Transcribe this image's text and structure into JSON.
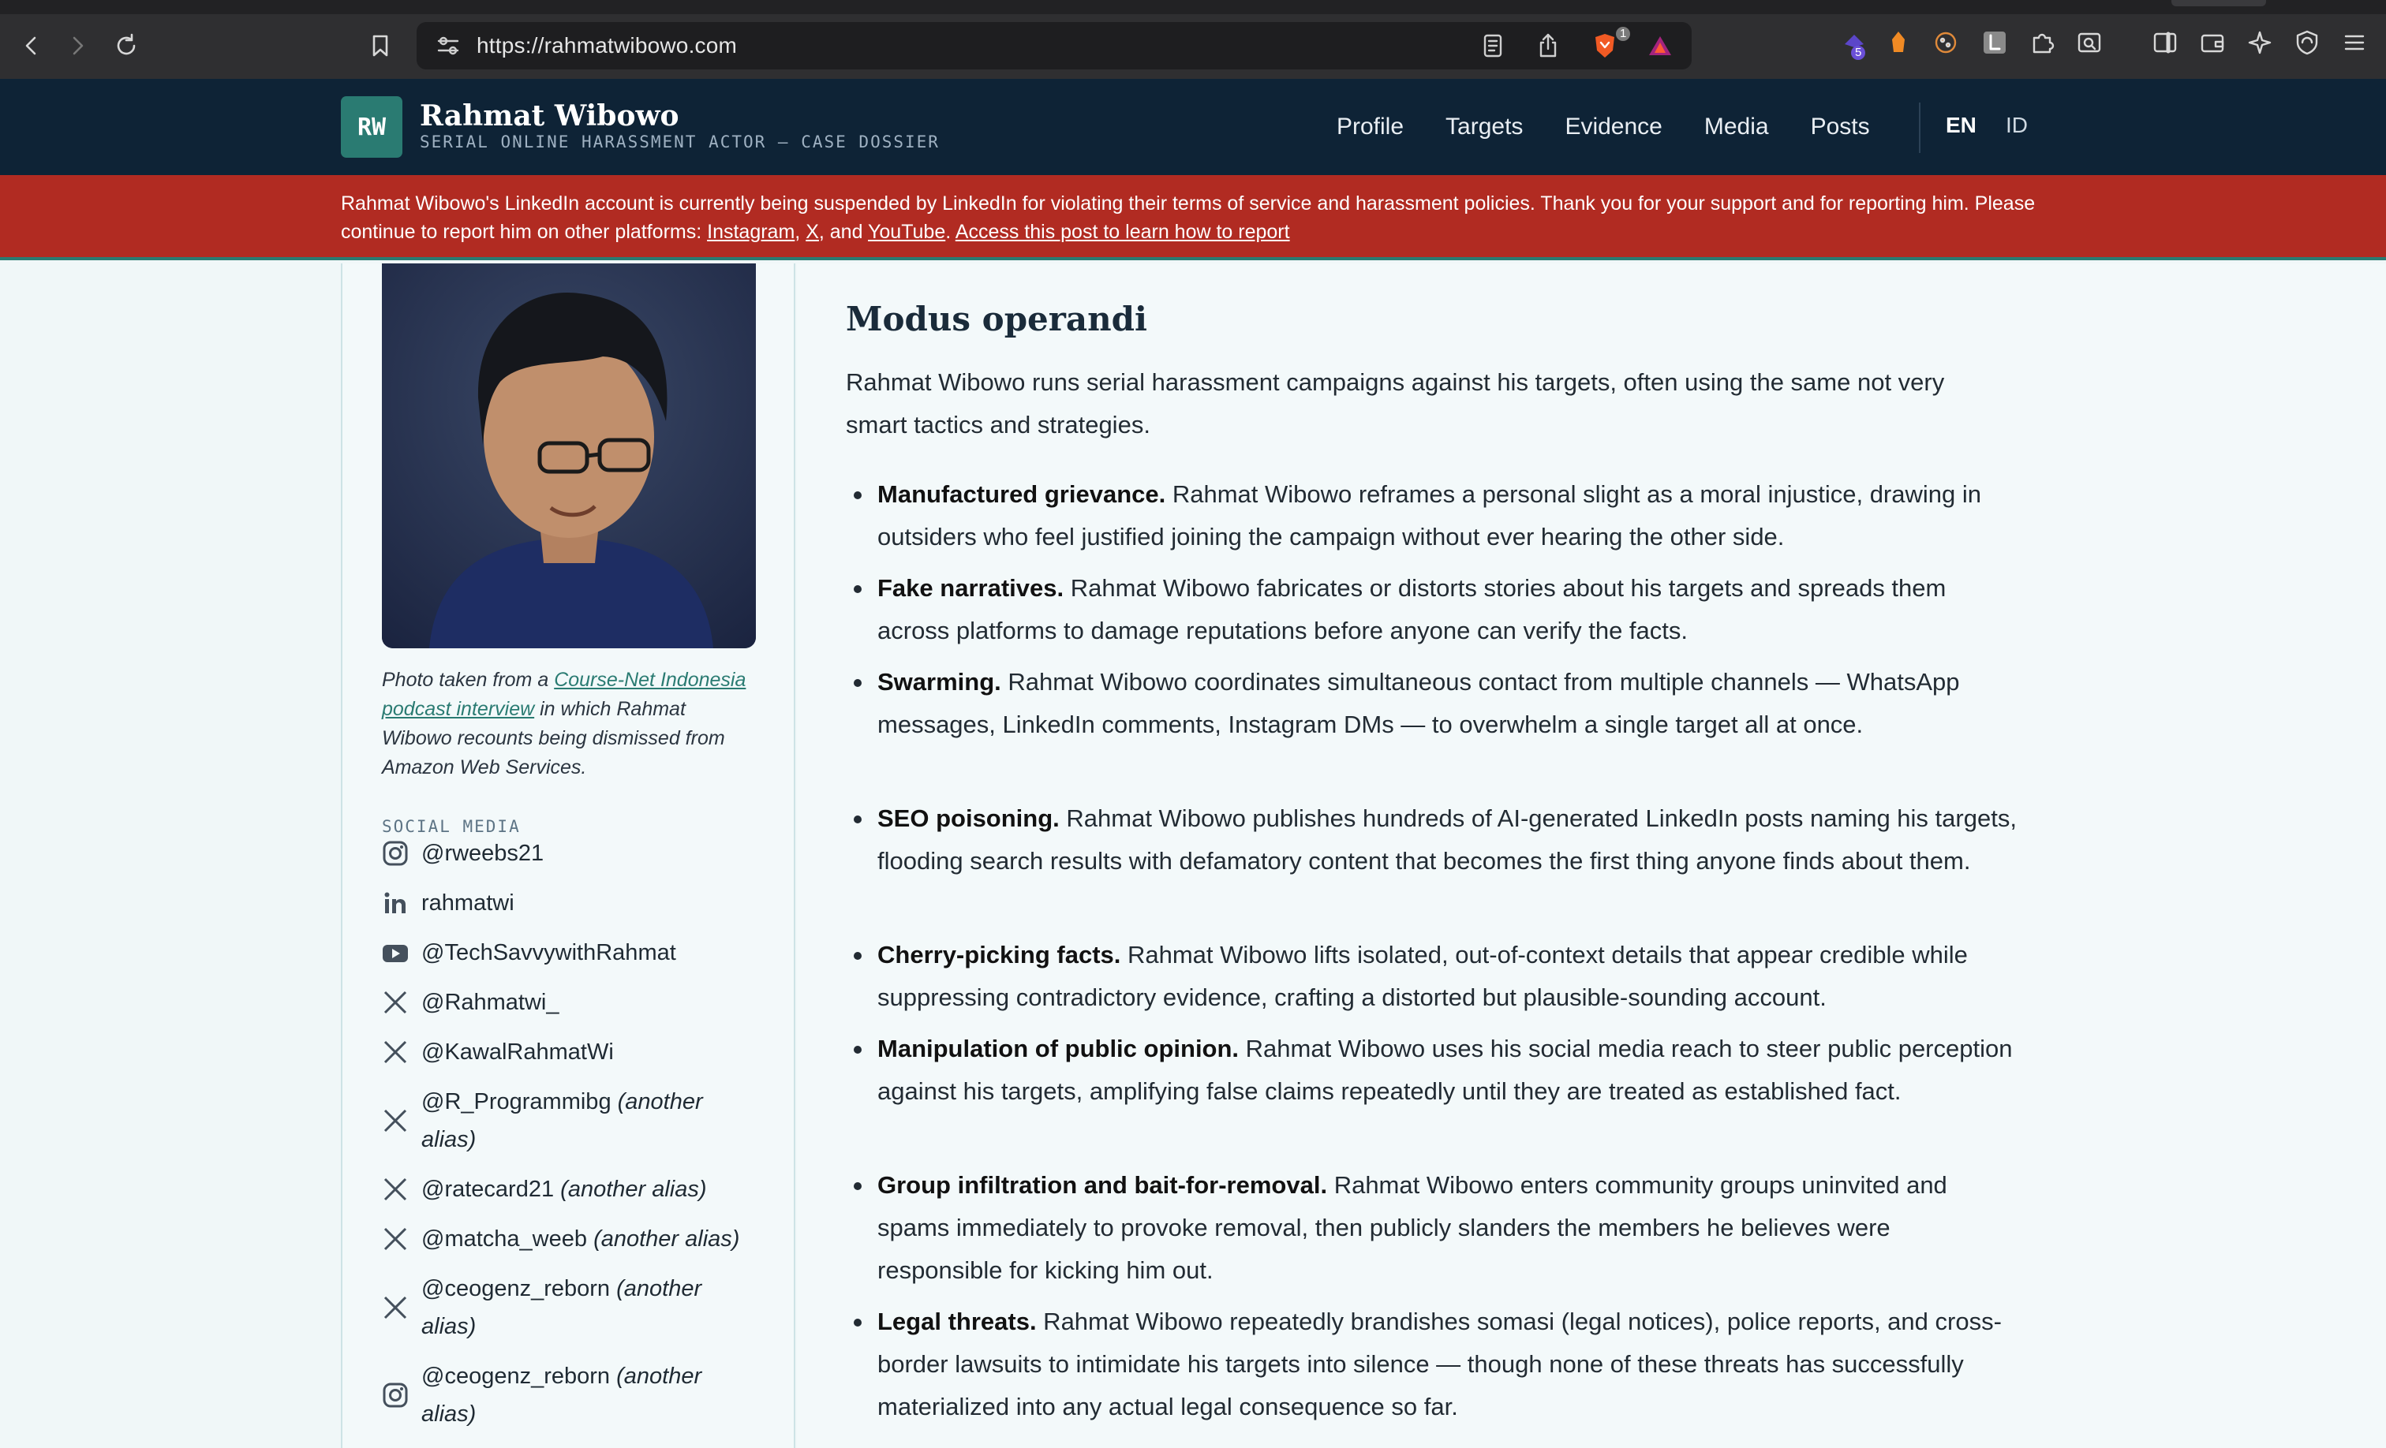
{
  "browser": {
    "url": "https://rahmatwibowo.com",
    "brave_badge": "1",
    "ext_badge": "5"
  },
  "header": {
    "logo": "RW",
    "title": "Rahmat Wibowo",
    "subtitle": "SERIAL ONLINE HARASSMENT ACTOR — CASE DOSSIER",
    "nav": [
      "Profile",
      "Targets",
      "Evidence",
      "Media",
      "Posts"
    ],
    "lang_en": "EN",
    "lang_id": "ID"
  },
  "banner": {
    "text_1": "Rahmat Wibowo's LinkedIn account is currently being suspended by LinkedIn for violating their terms of service and harassment policies. Thank you for your support and for reporting him. Please continue to report him on other platforms: ",
    "link_instagram": "Instagram",
    "sep_1": ", ",
    "link_x": "X",
    "sep_2": ", and ",
    "link_youtube": "YouTube",
    "sep_3": ". ",
    "link_report": "Access this post to learn how to report"
  },
  "sidebar": {
    "caption_pre": "Photo taken from a ",
    "caption_link": "Course-Net Indonesia podcast interview",
    "caption_post": " in which Rahmat Wibowo recounts being dismissed from Amazon Web Services.",
    "social_heading": "SOCIAL MEDIA",
    "accounts": [
      {
        "handle": "@rweebs21",
        "alias": "",
        "icon": "instagram-icon"
      },
      {
        "handle": "rahmatwi",
        "alias": "",
        "icon": "linkedin-icon"
      },
      {
        "handle": "@TechSavvywithRahmat",
        "alias": "",
        "icon": "youtube-icon"
      },
      {
        "handle": "@Rahmatwi_",
        "alias": "",
        "icon": "x-icon"
      },
      {
        "handle": "@KawalRahmatWi",
        "alias": "",
        "icon": "x-icon"
      },
      {
        "handle": "@R_Programmibg",
        "alias": "(another alias)",
        "icon": "x-icon"
      },
      {
        "handle": "@ratecard21",
        "alias": "(another alias)",
        "icon": "x-icon"
      },
      {
        "handle": "@matcha_weeb",
        "alias": "(another alias)",
        "icon": "x-icon"
      },
      {
        "handle": "@ceogenz_reborn",
        "alias": "(another alias)",
        "icon": "x-icon"
      },
      {
        "handle": "@ceogenz_reborn",
        "alias": "(another alias)",
        "icon": "instagram-icon"
      }
    ]
  },
  "main": {
    "heading": "Modus operandi",
    "intro": "Rahmat Wibowo runs serial harassment campaigns against his targets, often using the same not very smart tactics and strategies.",
    "tactics": [
      {
        "title": "Manufactured grievance.",
        "text": " Rahmat Wibowo reframes a personal slight as a moral injustice, drawing in outsiders who feel justified joining the campaign without ever hearing the other side."
      },
      {
        "title": "Fake narratives.",
        "text": " Rahmat Wibowo fabricates or distorts stories about his targets and spreads them across platforms to damage reputations before anyone can verify the facts."
      },
      {
        "title": "Swarming.",
        "text": " Rahmat Wibowo coordinates simultaneous contact from multiple channels — WhatsApp messages, LinkedIn comments, Instagram DMs — to overwhelm a single target all at once."
      },
      {
        "title": "SEO poisoning.",
        "text": " Rahmat Wibowo publishes hundreds of AI-generated LinkedIn posts naming his targets, flooding search results with defamatory content that becomes the first thing anyone finds about them."
      },
      {
        "title": "Cherry-picking facts.",
        "text": " Rahmat Wibowo lifts isolated, out-of-context details that appear credible while suppressing contradictory evidence, crafting a distorted but plausible-sounding account."
      },
      {
        "title": "Manipulation of public opinion.",
        "text": " Rahmat Wibowo uses his social media reach to steer public perception against his targets, amplifying false claims repeatedly until they are treated as established fact."
      },
      {
        "title": "Group infiltration and bait-for-removal.",
        "text": " Rahmat Wibowo enters community groups uninvited and spams immediately to provoke removal, then publicly slanders the members he believes were responsible for kicking him out."
      },
      {
        "title": "Legal threats.",
        "text": " Rahmat Wibowo repeatedly brandishes somasi (legal notices), police reports, and cross-border lawsuits to intimidate his targets into silence — though none of these threats has successfully materialized into any actual legal consequence so far."
      }
    ]
  }
}
